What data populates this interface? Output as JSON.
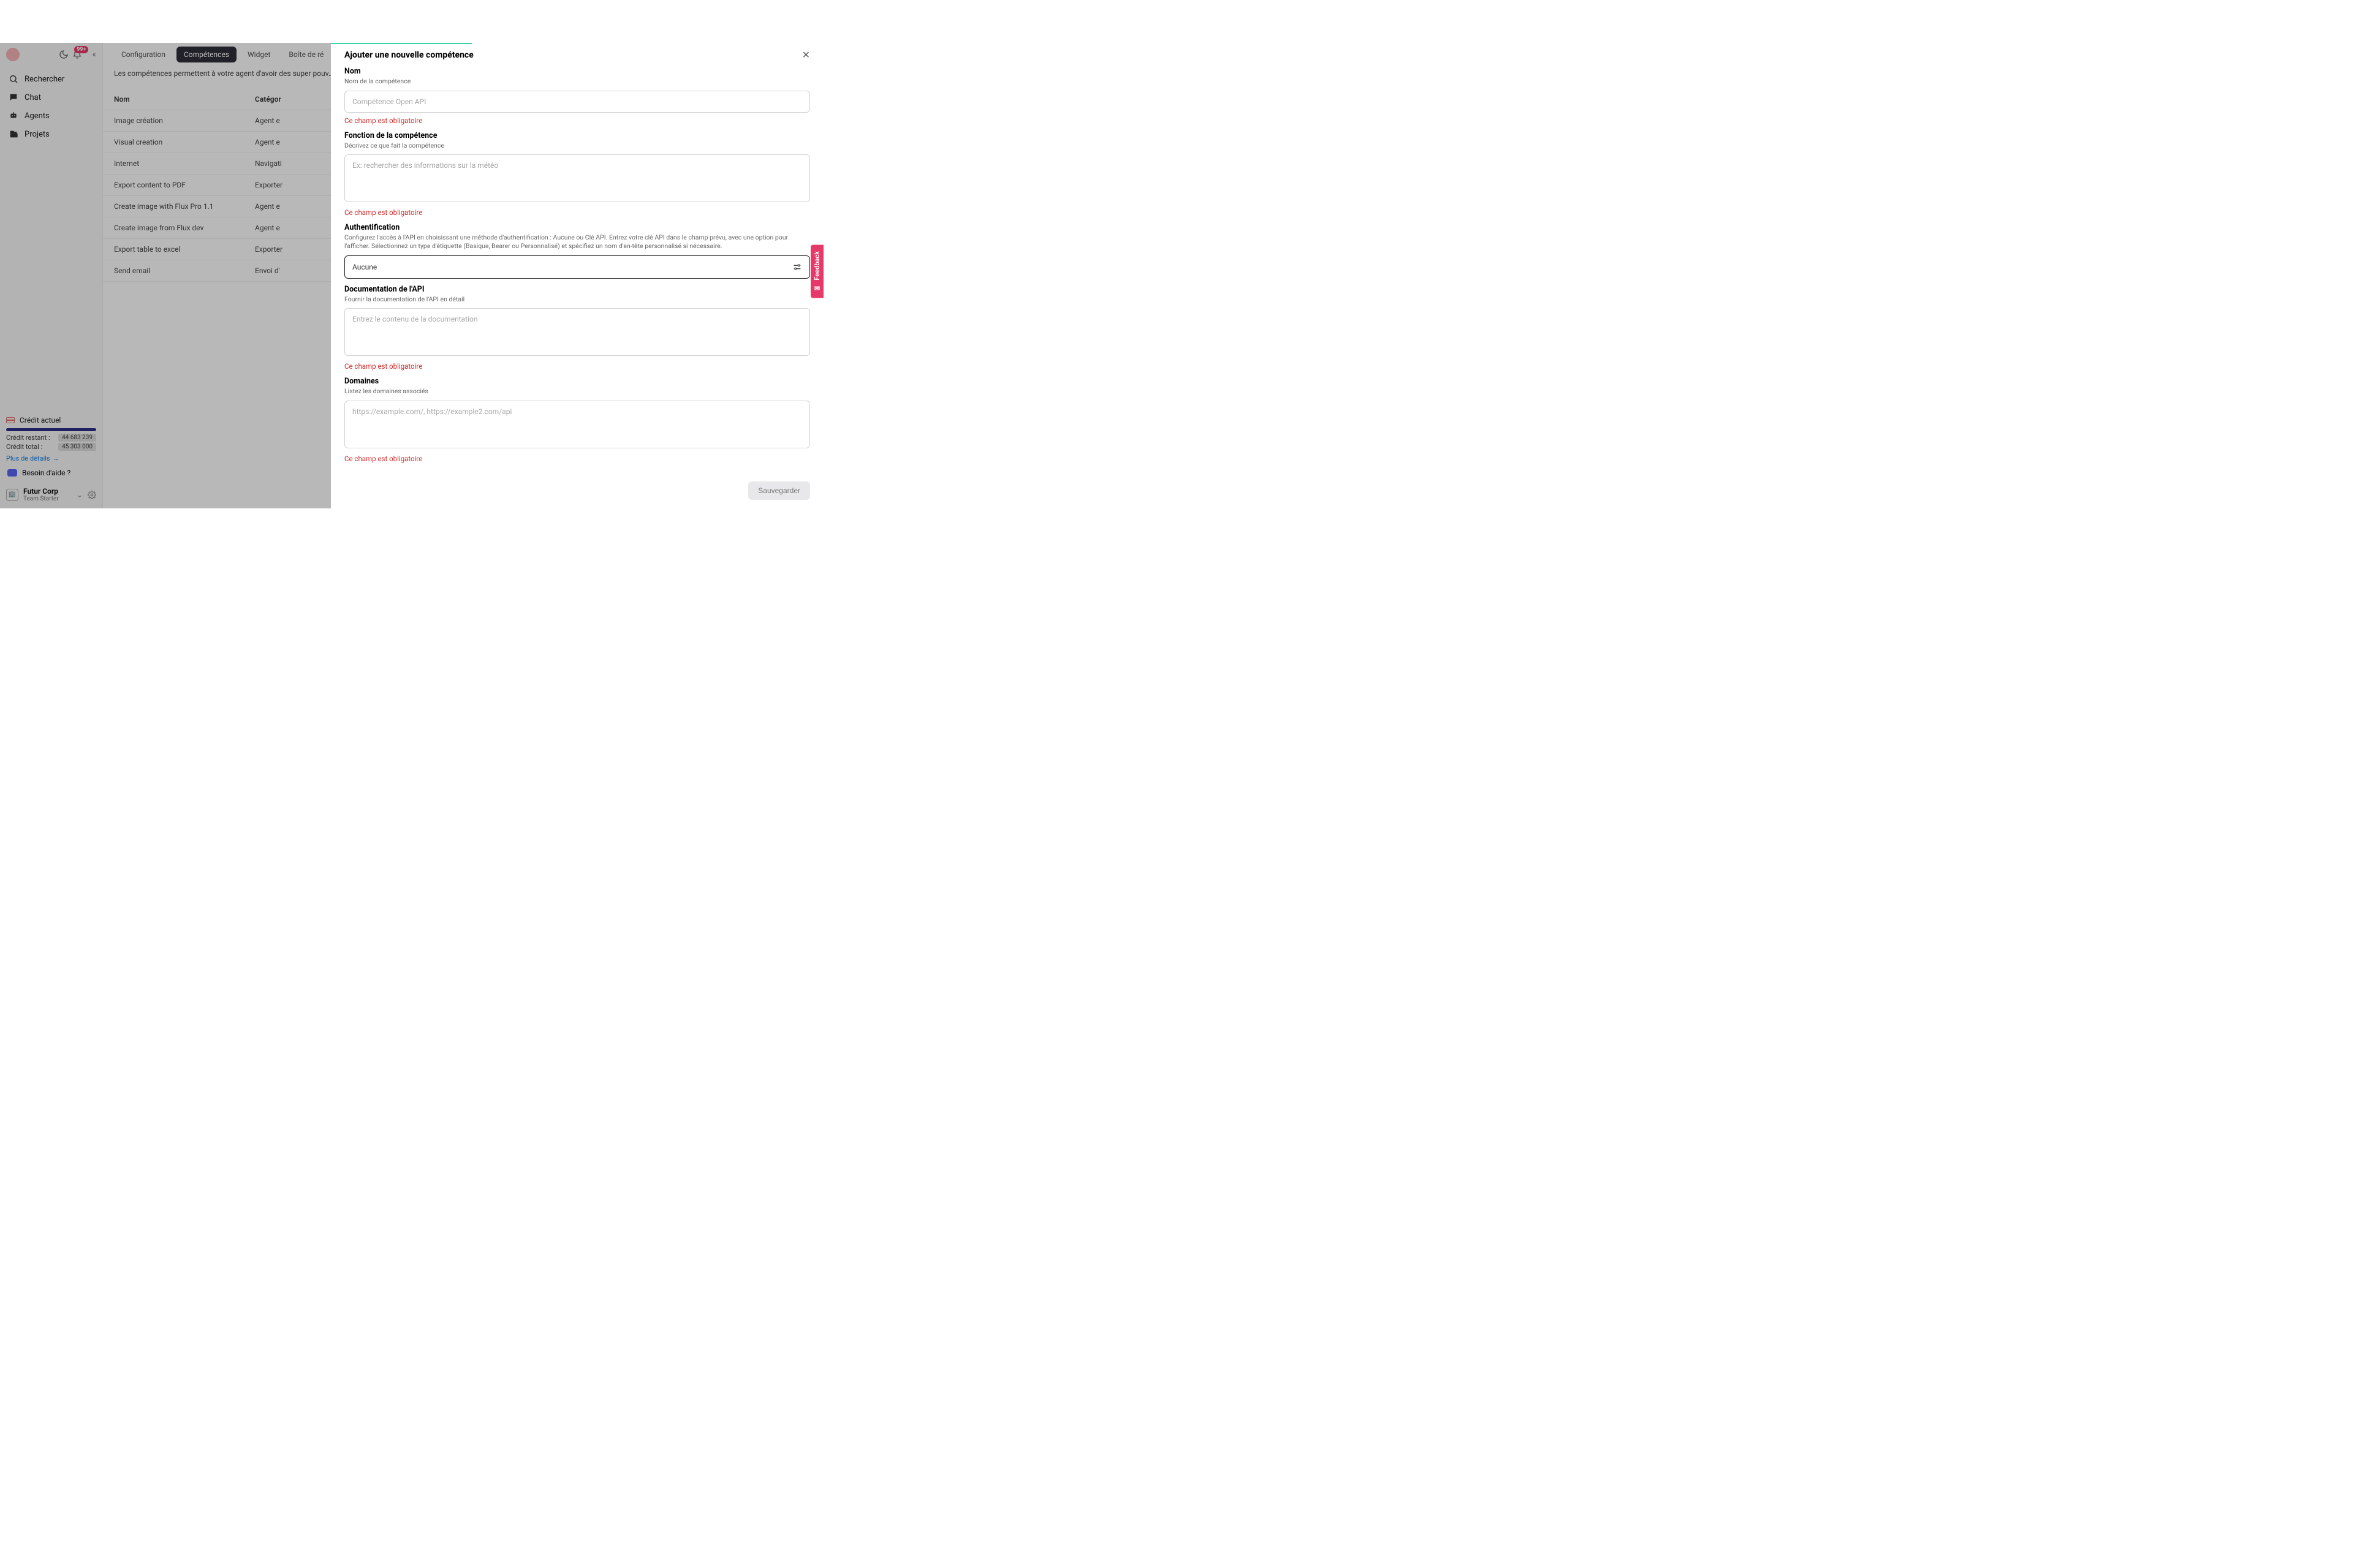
{
  "sidebar": {
    "notification_badge": "99+",
    "nav": [
      {
        "label": "Rechercher",
        "icon": "search-icon"
      },
      {
        "label": "Chat",
        "icon": "chat-icon"
      },
      {
        "label": "Agents",
        "icon": "agents-icon"
      },
      {
        "label": "Projets",
        "icon": "projects-icon"
      }
    ],
    "credit": {
      "title": "Crédit actuel",
      "remaining_label": "Crédit restant :",
      "remaining_value": "44 683 239",
      "total_label": "Crédit total :",
      "total_value": "45 303 000",
      "more": "Plus de détails"
    },
    "help": "Besoin d'aide ?",
    "org": {
      "name": "Futur Corp",
      "plan": "Team Starter"
    }
  },
  "main": {
    "tabs": [
      "Configuration",
      "Compétences",
      "Widget",
      "Boîte de ré"
    ],
    "active_tab": 1,
    "description": "Les compétences permettent à votre agent d'avoir des super pouv… plus encore.",
    "cols": [
      "Nom",
      "Catégor"
    ],
    "rows": [
      {
        "name": "Image création",
        "cat": "Agent e"
      },
      {
        "name": "Visual creation",
        "cat": "Agent e"
      },
      {
        "name": "Internet",
        "cat": "Navigati"
      },
      {
        "name": "Export content to PDF",
        "cat": "Exporter"
      },
      {
        "name": "Create image with Flux Pro 1.1",
        "cat": "Agent e"
      },
      {
        "name": "Create image from Flux dev",
        "cat": "Agent e"
      },
      {
        "name": "Export table to excel",
        "cat": "Exporter"
      },
      {
        "name": "Send email",
        "cat": "Envoi d'"
      }
    ]
  },
  "modal": {
    "title": "Ajouter une nouvelle compétence",
    "fields": {
      "name": {
        "label": "Nom",
        "help": "Nom de la compétence",
        "placeholder": "Compétence Open API",
        "error": "Ce champ est obligatoire"
      },
      "function": {
        "label": "Fonction de la compétence",
        "help": "Décrivez ce que fait la compétence",
        "placeholder": "Ex: rechercher des informations sur la météo",
        "error": "Ce champ est obligatoire"
      },
      "auth": {
        "label": "Authentification",
        "help": "Configurez l'accès à l'API en choisissant une méthode d'authentification : Aucune ou Clé API. Entrez votre clé API dans le champ prévu, avec une option pour l'afficher. Sélectionnez un type d'étiquette (Basique, Bearer ou Personnalisé) et spécifiez un nom d'en-tête personnalisé si nécessaire.",
        "value": "Aucune"
      },
      "doc": {
        "label": "Documentation de l'API",
        "help": "Fournir la documentation de l'API en détail",
        "placeholder": "Entrez le contenu de la documentation",
        "error": "Ce champ est obligatoire"
      },
      "domains": {
        "label": "Domaines",
        "help": "Listez les domaines associés",
        "placeholder": "https://example.com/, https://example2.com/api",
        "error": "Ce champ est obligatoire"
      }
    },
    "save": "Sauvegarder"
  },
  "feedback_label": "Feedback"
}
